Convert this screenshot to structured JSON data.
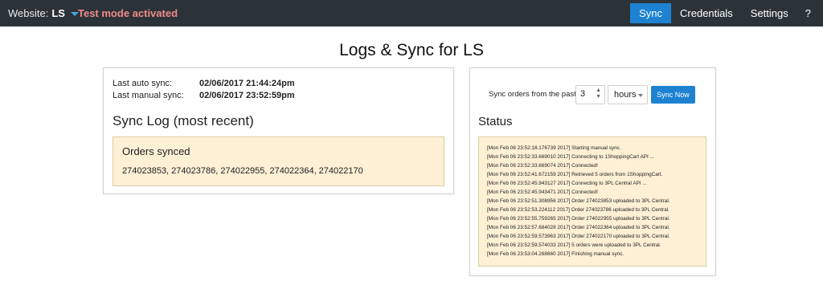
{
  "nav": {
    "website_label": "Website:",
    "website_value": "LS",
    "test_mode": "Test mode activated",
    "items": [
      "Sync",
      "Credentials",
      "Settings",
      "?"
    ]
  },
  "page_title": "Logs & Sync for LS",
  "sync_info": {
    "auto_label": "Last auto sync:",
    "auto_value": "02/06/2017 21:44:24pm",
    "manual_label": "Last manual sync:",
    "manual_value": "02/06/2017 23:52:59pm"
  },
  "sync_log": {
    "title": "Sync Log (most recent)",
    "orders_heading": "Orders synced",
    "orders": "274023853, 274023786, 274022955, 274022364, 274022170"
  },
  "sync_form": {
    "label": "Sync orders from the past",
    "amount": "3",
    "unit": "hours",
    "button": "Sync Now"
  },
  "status": {
    "title": "Status",
    "lines": [
      "[Mon Feb 06 23:52:18.176739 2017] Starting manual sync.",
      "[Mon Feb 06 23:52:33.669010 2017] Connecting to 1ShoppingCart API ...",
      "[Mon Feb 06 23:52:33.669074 2017] Connected!",
      "[Mon Feb 06 23:52:41.672159 2017] Retrieved 5 orders from 1ShoppingCart.",
      "[Mon Feb 06 23:52:45.943127 2017] Connecting to 3PL Central API ...",
      "[Mon Feb 06 23:52:45.943471 2017] Connected!",
      "[Mon Feb 06 23:52:51.308956 2017] Order 274023853 uploaded to 3PL Central.",
      "[Mon Feb 06 23:52:53.224112 2017] Order 274023786 uploaded to 3PL Central.",
      "[Mon Feb 06 23:52:55.759265 2017] Order 274022955 uploaded to 3PL Central.",
      "[Mon Feb 06 23:52:57.684028 2017] Order 274022364 uploaded to 3PL Central.",
      "[Mon Feb 06 23:52:59.573963 2017] Order 274022170 uploaded to 3PL Central.",
      "[Mon Feb 06 23:52:59.574033 2017] 5 orders were uploaded to 3PL Central.",
      "[Mon Feb 06 23:53:04.268660 2017] Finishing manual sync."
    ]
  },
  "colors": {
    "nav_bg": "#2c3338",
    "accent": "#1d82d2",
    "test_mode": "#f08a8a",
    "notice_bg": "#fdf0d5"
  }
}
